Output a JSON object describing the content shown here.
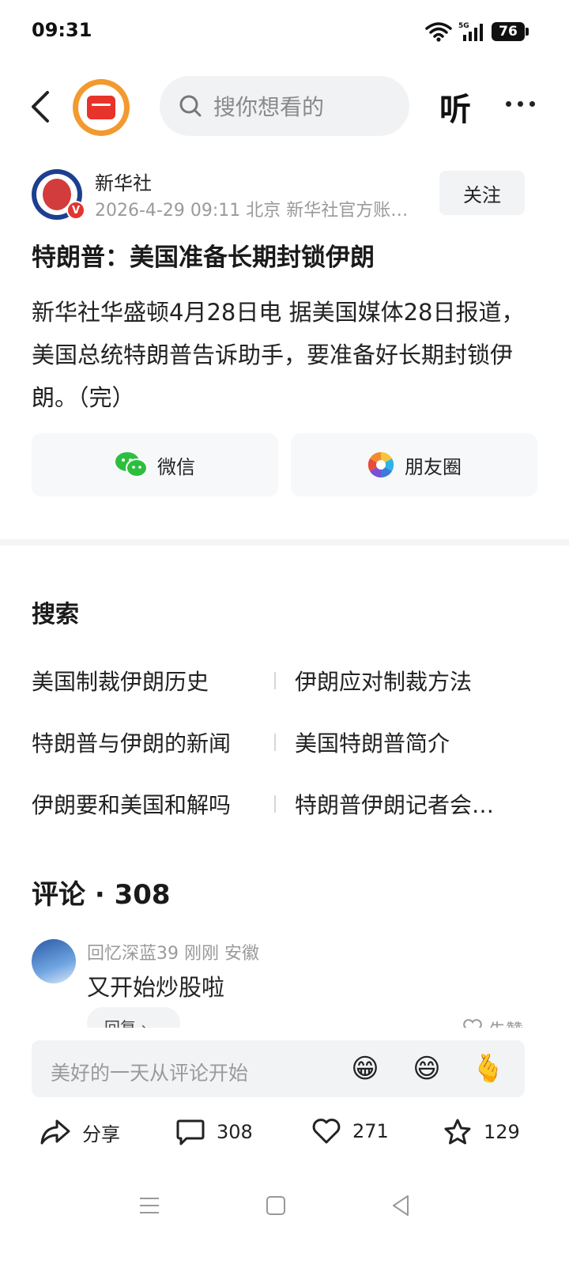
{
  "status": {
    "time": "09:31",
    "battery": "76",
    "network": "5G"
  },
  "header": {
    "search_placeholder": "搜你想看的",
    "listen_label": "听"
  },
  "author": {
    "name": "新华社",
    "meta": "2026-4-29  09:11  北京  新华社官方账…",
    "follow_label": "关注",
    "verified_badge": "V"
  },
  "article": {
    "title": "特朗普：美国准备长期封锁伊朗",
    "body": "新华社华盛顿4月28日电 据美国媒体28日报道，美国总统特朗普告诉助手，要准备好长期封锁伊朗。（完）"
  },
  "share": {
    "wechat_label": "微信",
    "moments_label": "朋友圈"
  },
  "search_section": {
    "title": "搜索",
    "rows": [
      [
        "美国制裁伊朗历史",
        "伊朗应对制裁方法"
      ],
      [
        "特朗普与伊朗的新闻",
        "美国特朗普简介"
      ],
      [
        "伊朗要和美国和解吗",
        "特朗普伊朗记者会…"
      ]
    ]
  },
  "comments": {
    "title": "评论 · 308",
    "items": [
      {
        "user": "回忆深蓝39",
        "time": "刚刚",
        "location": "安徽",
        "meta": "回忆深蓝39  刚刚  安徽",
        "text": "又开始炒股啦",
        "reply_label": "回复 ›",
        "like_label": "先赞"
      }
    ]
  },
  "input": {
    "placeholder": "美好的一天从评论开始",
    "emojis": [
      "😁",
      "😄",
      "🫰"
    ]
  },
  "actions": {
    "share_label": "分享",
    "comment_count": "308",
    "like_count": "271",
    "favorite_count": "129"
  }
}
